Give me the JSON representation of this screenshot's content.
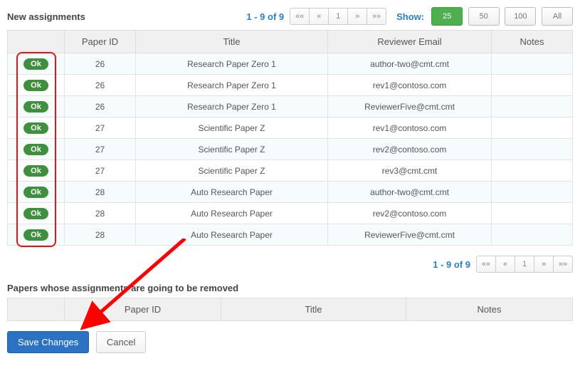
{
  "sections": {
    "new_assignments": "New assignments",
    "removed": "Papers whose assignments are going to be removed"
  },
  "pager": {
    "range": "1 - 9 of 9",
    "first": "««",
    "prev": "«",
    "page": "1",
    "next": "»",
    "last": "»»"
  },
  "show": {
    "label": "Show:",
    "opts": [
      "25",
      "50",
      "100",
      "All"
    ],
    "active": "25"
  },
  "table1": {
    "headers": {
      "status": "",
      "paper_id": "Paper ID",
      "title": "Title",
      "email": "Reviewer Email",
      "notes": "Notes"
    },
    "rows": [
      {
        "status": "Ok",
        "id": "26",
        "title": "Research Paper Zero 1",
        "email": "author-two@cmt.cmt",
        "notes": ""
      },
      {
        "status": "Ok",
        "id": "26",
        "title": "Research Paper Zero 1",
        "email": "rev1@contoso.com",
        "notes": ""
      },
      {
        "status": "Ok",
        "id": "26",
        "title": "Research Paper Zero 1",
        "email": "ReviewerFive@cmt.cmt",
        "notes": ""
      },
      {
        "status": "Ok",
        "id": "27",
        "title": "Scientific Paper Z",
        "email": "rev1@contoso.com",
        "notes": ""
      },
      {
        "status": "Ok",
        "id": "27",
        "title": "Scientific Paper Z",
        "email": "rev2@contoso.com",
        "notes": ""
      },
      {
        "status": "Ok",
        "id": "27",
        "title": "Scientific Paper Z",
        "email": "rev3@cmt.cmt",
        "notes": ""
      },
      {
        "status": "Ok",
        "id": "28",
        "title": "Auto Research Paper",
        "email": "author-two@cmt.cmt",
        "notes": ""
      },
      {
        "status": "Ok",
        "id": "28",
        "title": "Auto Research Paper",
        "email": "rev2@contoso.com",
        "notes": ""
      },
      {
        "status": "Ok",
        "id": "28",
        "title": "Auto Research Paper",
        "email": "ReviewerFive@cmt.cmt",
        "notes": ""
      }
    ]
  },
  "table2": {
    "headers": {
      "status": "",
      "paper_id": "Paper ID",
      "title": "Title",
      "notes": "Notes"
    }
  },
  "actions": {
    "save": "Save Changes",
    "cancel": "Cancel"
  },
  "annotation": {
    "highlight_color": "#e11",
    "arrow_color": "#ff0000"
  }
}
